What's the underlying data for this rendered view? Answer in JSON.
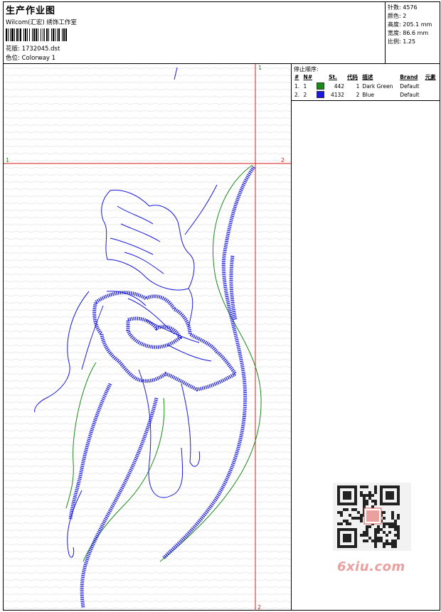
{
  "header": {
    "title": "生产作业图",
    "studio": "Wilcom(汇宏) 绣饰工作室",
    "design_label": "花版:",
    "design_value": "1732045.dst",
    "colorway_label": "色位:",
    "colorway_value": "Colorway 1"
  },
  "stats": [
    {
      "label": "针数:",
      "value": "4576"
    },
    {
      "label": "颜色:",
      "value": "2"
    },
    {
      "label": "高度:",
      "value": "205.1 mm"
    },
    {
      "label": "宽度:",
      "value": "86.6 mm"
    },
    {
      "label": "比例:",
      "value": "1.25"
    }
  ],
  "stop_sequence": {
    "title": "停止顺序:",
    "columns": [
      "#",
      "N#",
      "St.",
      "代码",
      "描述",
      "Brand",
      "元素"
    ],
    "rows": [
      {
        "idx": "1.",
        "n": "1",
        "color": "#1a8a1a",
        "st": "442",
        "code": "1",
        "desc": "Dark Green",
        "brand": "Default"
      },
      {
        "idx": "2.",
        "n": "2",
        "color": "#1a1adc",
        "st": "4132",
        "code": "2",
        "desc": "Blue",
        "brand": "Default"
      }
    ]
  },
  "canvas": {
    "marker_top": "1",
    "marker_left": "1",
    "marker_right": "2",
    "marker_bottom": "2",
    "colors": {
      "guide": "#d81b1b",
      "green": "#1a8a1a",
      "blue": "#1a1adc",
      "grid": "#dcdcdc"
    }
  },
  "watermark": "6xiu.com"
}
